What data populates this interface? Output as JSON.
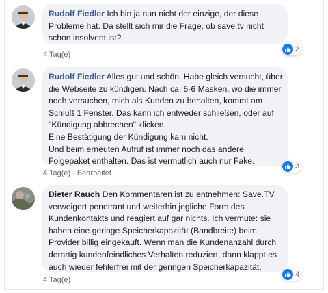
{
  "comments": [
    {
      "author": "Rudolf Fiedler",
      "lines": [
        "Ich bin ja nun nicht der einzige, der diese",
        "Probleme hat. Da stellt sich mir die Frage, ob save.tv nicht",
        "schon insolvent ist?"
      ],
      "time": "4 Tag(e)",
      "reaction_icon": "like-icon",
      "reaction_count": "2"
    },
    {
      "author": "Rudolf Fiedler",
      "lines": [
        "Alles gut und schön. Habe gleich versucht, über",
        "die Webseite zu kündigen. Nach ca. 5-6 Masken, wo die immer",
        "noch versuchen, mich als Kunden zu behalten, kommt am",
        "Schluß 1 Fenster. Das kann ich entweder schließen, oder auf",
        "\"Kündigung abbrechen\" klicken.",
        "Eine Bestätigung der Kündigung kam nicht.",
        "Und beim erneuten Aufruf ist immer noch das andere",
        "Folgepaket enthalten. Das ist vermutlich auch nur Fake."
      ],
      "time": "4 Tag(e)",
      "separator": "·",
      "edited": "Bearbeitet",
      "reaction_icon": "like-icon",
      "reaction_count": "3"
    },
    {
      "author": "Dieter Rauch",
      "lines": [
        "Den Kommentaren ist zu entnehmen: Save.TV",
        "verweigert penetrant und weiterhin jegliche Form des",
        "Kundenkontakts und reagiert auf gar nichts. Ich vermute: sie",
        "haben eine geringe Speicherkapazität (Bandbreite) beim",
        "Provider billig eingekauft. Wenn man die Kundenanzahl durch",
        "derartig kundenfeindliches Verhalten reduziert, dann klappt es",
        "auch wieder fehlerfrei mit der geringen Speicherkapazität."
      ],
      "time": "4 Tag(e)",
      "reaction_icon": "like-icon",
      "reaction_count": "4"
    }
  ],
  "colors": {
    "bubble": "#f0f2f5",
    "author_link": "#385898",
    "like_blue": "#1877f2",
    "meta_gray": "#65676b"
  }
}
